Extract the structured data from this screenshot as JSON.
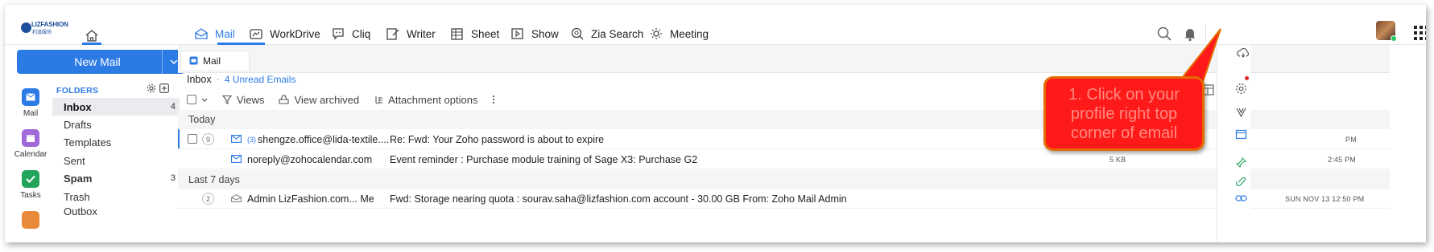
{
  "brand": {
    "logo_text": "LIZFASHION",
    "logo_sub": "利滋服饰"
  },
  "colors": {
    "accent": "#2c7be5",
    "callout_fill": "#ff1a1a",
    "callout_border": "#e56b00",
    "callout_text": "#ff8a80"
  },
  "nav": [
    {
      "label": "Mail",
      "icon": "mail-icon",
      "active": true
    },
    {
      "label": "WorkDrive",
      "icon": "workdrive-icon"
    },
    {
      "label": "Cliq",
      "icon": "cliq-icon"
    },
    {
      "label": "Writer",
      "icon": "writer-icon"
    },
    {
      "label": "Sheet",
      "icon": "sheet-icon"
    },
    {
      "label": "Show",
      "icon": "show-icon"
    },
    {
      "label": "Zia Search",
      "icon": "zia-search-icon"
    },
    {
      "label": "Meeting",
      "icon": "meeting-icon"
    }
  ],
  "rail": [
    {
      "label": "Mail",
      "icon": "mail-icon"
    },
    {
      "label": "Calendar",
      "icon": "calendar-icon"
    },
    {
      "label": "Tasks",
      "icon": "tasks-icon"
    }
  ],
  "new_mail": {
    "label": "New Mail"
  },
  "folders": {
    "heading": "FOLDERS",
    "items": [
      {
        "label": "Inbox",
        "count": "4"
      },
      {
        "label": "Drafts",
        "count": ""
      },
      {
        "label": "Templates",
        "count": ""
      },
      {
        "label": "Sent",
        "count": ""
      },
      {
        "label": "Spam",
        "count": "3"
      },
      {
        "label": "Trash",
        "count": ""
      },
      {
        "label": "Outbox",
        "count": ""
      }
    ]
  },
  "tab": {
    "label": "Mail"
  },
  "breadcrumb": {
    "folder": "Inbox",
    "separator": "·",
    "unread": "4 Unread Emails"
  },
  "toolbar": {
    "views": "Views",
    "archived": "View archived",
    "attachments": "Attachment options"
  },
  "groups": {
    "today": "Today",
    "last7": "Last 7 days"
  },
  "emails": [
    {
      "thread_count": "9",
      "sender_count": "(3)",
      "sender": "shengze.office@lida-textile....",
      "subject": "Re: Fwd: Your Zoho password is about to expire",
      "size": "",
      "time": "PM"
    },
    {
      "thread_count": "",
      "sender_count": "",
      "sender": "noreply@zohocalendar.com",
      "subject": "Event reminder : Purchase module training of Sage X3: Purchase G2",
      "size": "5 KB",
      "time": "2:45 PM"
    },
    {
      "thread_count": "2",
      "sender_count": "",
      "sender": "Admin LizFashion.com... Me",
      "subject": "Fwd: Storage nearing quota : sourav.saha@lizfashion.com account - 30.00 GB From: Zoho Mail Admin",
      "size": "",
      "time": "SUN NOV 13 12:50 PM"
    }
  ],
  "callout": {
    "text": "1. Click on your profile right top corner of email"
  }
}
